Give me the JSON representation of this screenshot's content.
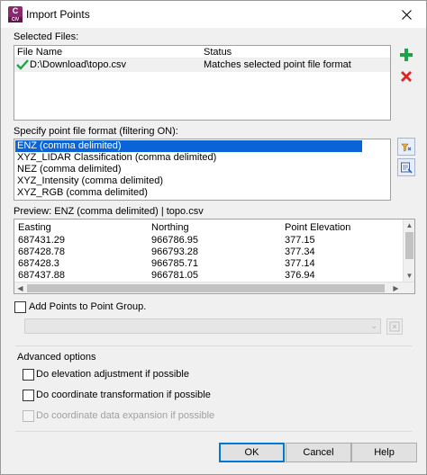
{
  "window": {
    "title": "Import Points",
    "app_icon": {
      "letter": "C",
      "sub": "CIV"
    }
  },
  "selected_files": {
    "label": "Selected Files:",
    "columns": [
      "File Name",
      "Status"
    ],
    "rows": [
      {
        "file": "D:\\Download\\topo.csv",
        "status": "Matches selected point file format"
      }
    ]
  },
  "side_buttons": {
    "add_icon": "plus-icon",
    "remove_icon": "delete-x-icon",
    "colors": {
      "add": "#1fa34a",
      "remove": "#e02424"
    }
  },
  "formats": {
    "label": "Specify point file format (filtering ON):",
    "items": [
      "ENZ (comma delimited)",
      "XYZ_LIDAR Classification (comma delimited)",
      "NEZ (comma delimited)",
      "XYZ_Intensity (comma delimited)",
      "XYZ_RGB (comma delimited)"
    ],
    "selected_index": 0
  },
  "preview": {
    "label": "Preview: ENZ (comma delimited) | topo.csv",
    "columns": [
      "Easting",
      "Northing",
      "Point Elevation"
    ],
    "rows": [
      [
        "687431.29",
        "966786.95",
        "377.15"
      ],
      [
        "687428.78",
        "966793.28",
        "377.34"
      ],
      [
        "687428.3",
        "966785.71",
        "377.14"
      ],
      [
        "687437.88",
        "966781.05",
        "376.94"
      ]
    ]
  },
  "point_group": {
    "label": "Add Points to Point Group.",
    "checked": false
  },
  "advanced": {
    "label": "Advanced options",
    "options": [
      {
        "label": "Do elevation adjustment if possible",
        "checked": false,
        "enabled": true
      },
      {
        "label": "Do coordinate transformation if possible",
        "checked": false,
        "enabled": true
      },
      {
        "label": "Do coordinate data expansion if possible",
        "checked": false,
        "enabled": false
      }
    ]
  },
  "buttons": {
    "ok": "OK",
    "cancel": "Cancel",
    "help": "Help"
  },
  "accent_color": "#0a64d8"
}
